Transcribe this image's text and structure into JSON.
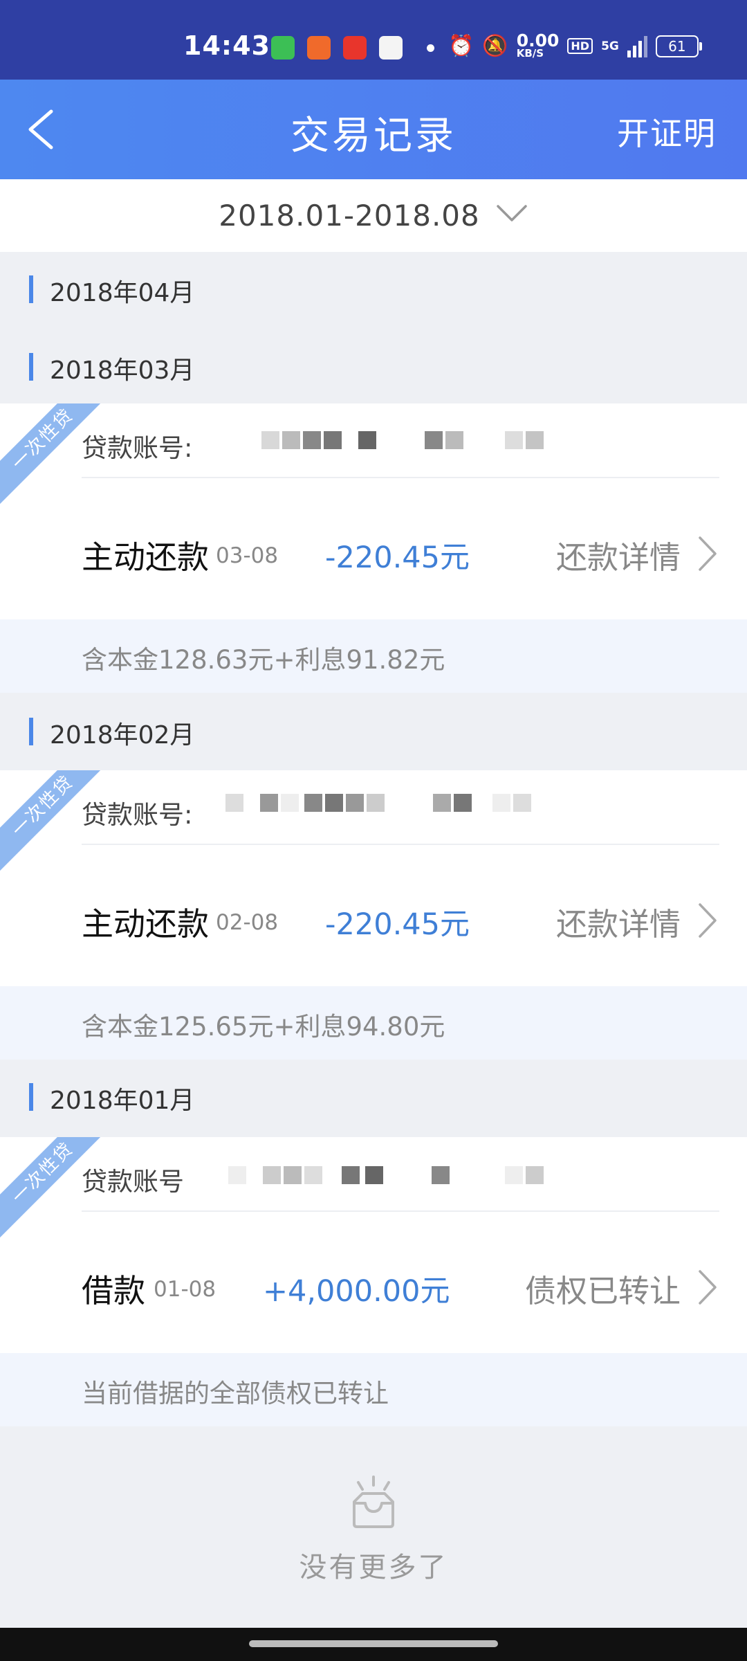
{
  "status_bar": {
    "time": "14:43",
    "speed_value": "0.00",
    "speed_unit": "KB/S",
    "hd": "HD",
    "network": "5G",
    "battery": "61"
  },
  "header": {
    "title": "交易记录",
    "action": "开证明"
  },
  "filter": {
    "range": "2018.01-2018.08"
  },
  "months": [
    {
      "label": "2018年04月"
    },
    {
      "label": "2018年03月"
    },
    {
      "label": "2018年02月"
    },
    {
      "label": "2018年01月"
    }
  ],
  "records": [
    {
      "ribbon": "一次性贷",
      "account_label": "贷款账号:",
      "type": "主动还款",
      "date": "03-08",
      "amount": "-220.45元",
      "link": "还款详情",
      "note": "含本金128.63元+利息91.82元"
    },
    {
      "ribbon": "一次性贷",
      "account_label": "贷款账号:",
      "type": "主动还款",
      "date": "02-08",
      "amount": "-220.45元",
      "link": "还款详情",
      "note": "含本金125.65元+利息94.80元"
    },
    {
      "ribbon": "一次性贷",
      "account_label": "贷款账号",
      "type": "借款",
      "date": "01-08",
      "amount": "+4,000.00元",
      "link": "债权已转让",
      "note": "当前借据的全部债权已转让"
    }
  ],
  "empty": {
    "text": "没有更多了"
  },
  "colors": {
    "status_bar": "#2f3fa3",
    "header": "#4e88f0",
    "accent": "#3f7fd6",
    "ribbon": "#8fb8f0"
  }
}
